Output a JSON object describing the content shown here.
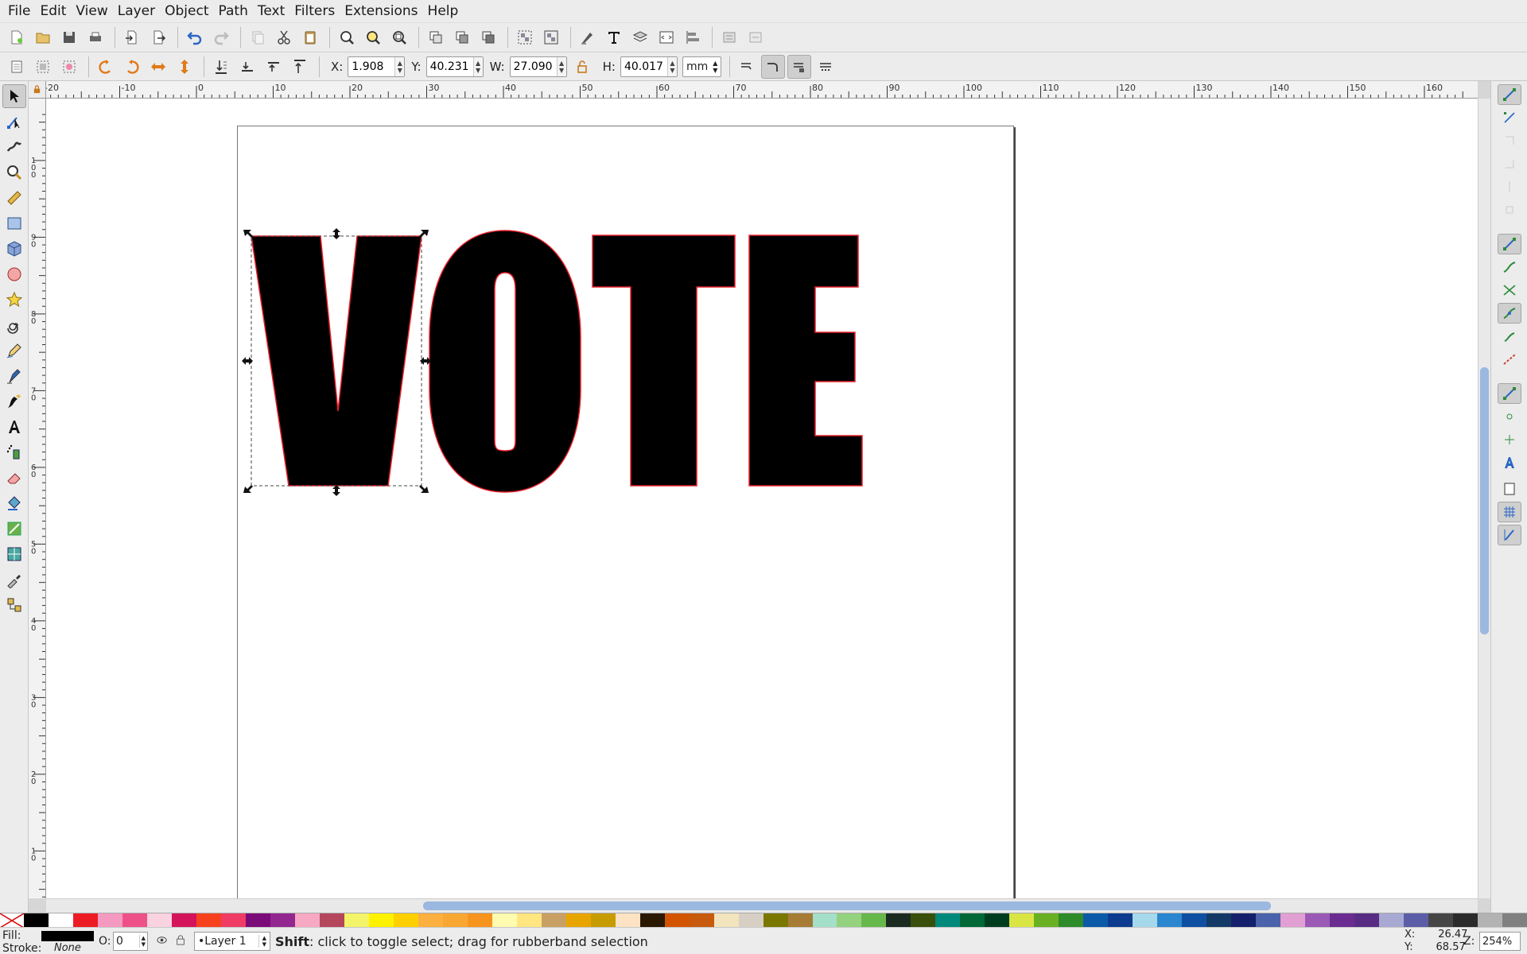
{
  "menu": [
    "File",
    "Edit",
    "View",
    "Layer",
    "Object",
    "Path",
    "Text",
    "Filters",
    "Extensions",
    "Help"
  ],
  "controls": {
    "x_label": "X:",
    "x_value": "1.908",
    "y_label": "Y:",
    "y_value": "40.231",
    "w_label": "W:",
    "w_value": "27.090",
    "h_label": "H:",
    "h_value": "40.017",
    "unit": "mm"
  },
  "ruler": {
    "h_ticks": [
      "-20",
      "-10",
      "0",
      "10",
      "20",
      "30",
      "40",
      "50",
      "60",
      "70",
      "80",
      "90",
      "100",
      "110",
      "120",
      "130",
      "140",
      "150",
      "160"
    ],
    "v_ticks": [
      "100",
      "90",
      "80",
      "70",
      "60",
      "50",
      "40",
      "30",
      "20",
      "10"
    ]
  },
  "canvas": {
    "text": "VOTE",
    "fill_color": "#000000",
    "outline_color": "#e8202a"
  },
  "palette": [
    "#000000",
    "#ffffff",
    "#ed1c24",
    "#f49ac1",
    "#ee5188",
    "#fbd3e0",
    "#d4145a",
    "#f7411d",
    "#f03c64",
    "#7b0b79",
    "#92278f",
    "#f7a8c3",
    "#b5475d",
    "#f3f46a",
    "#fff200",
    "#ffd000",
    "#fbb040",
    "#f8a832",
    "#f7941d",
    "#fffbb0",
    "#ffe680",
    "#c9a063",
    "#e8a500",
    "#c79c00",
    "#fde3c3",
    "#2a1800",
    "#d35400",
    "#c85a0e",
    "#f2e5bd",
    "#d8cfc4",
    "#7a7700",
    "#a67c35",
    "#a3dfc9",
    "#95d27f",
    "#67b84a",
    "#1b2b20",
    "#3a4f0b",
    "#00897b",
    "#006837",
    "#003d1f",
    "#d9e542",
    "#6ab023",
    "#2e8b2a",
    "#0b5aa8",
    "#0c3b8f",
    "#a6d8ec",
    "#2a86cf",
    "#0e4fa1",
    "#133a66",
    "#14206b",
    "#4a63aa",
    "#e29fd3",
    "#9b59b6",
    "#6a2c91",
    "#582c83",
    "#a8a9d2",
    "#5b5ea6",
    "#464646",
    "#2b2b2b",
    "#b3b3b3",
    "#808080"
  ],
  "status": {
    "fill_label": "Fill:",
    "stroke_label": "Stroke:",
    "stroke_value": "None",
    "opacity_label": "O:",
    "opacity_value": "0",
    "layer": "•Layer 1",
    "message_bold": "Shift",
    "message_rest": ": click to toggle select; drag for rubberband selection",
    "x_coord": "X:       26.47",
    "y_coord": "Y:       68.57",
    "zoom_label": "Z:",
    "zoom_value": "254%"
  }
}
